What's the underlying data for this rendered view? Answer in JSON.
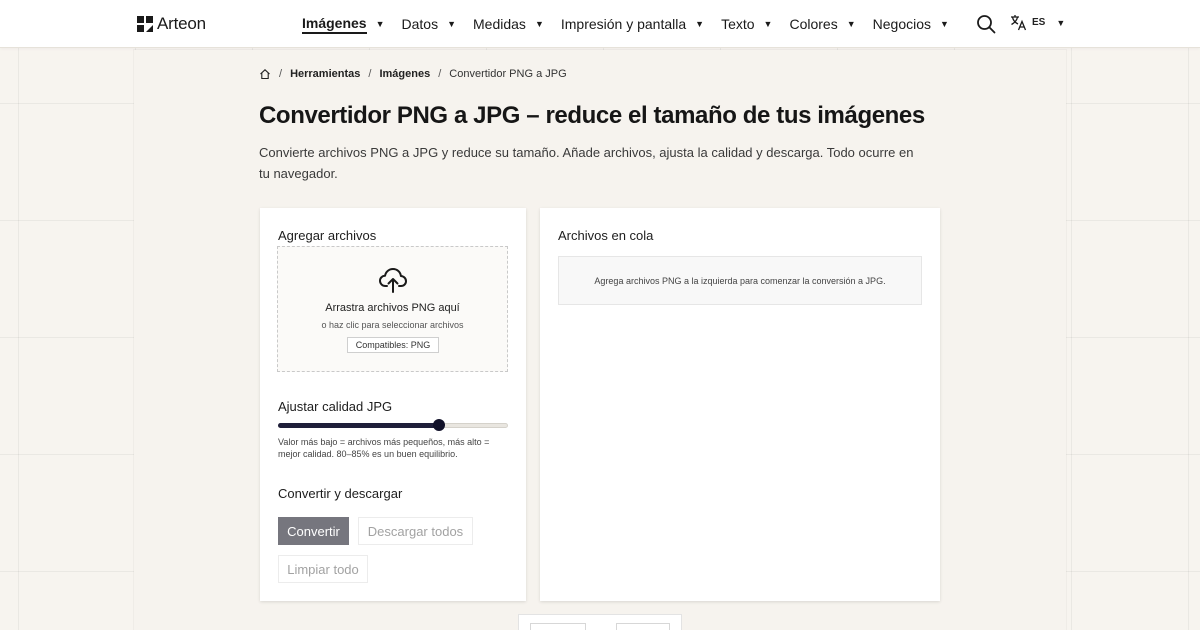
{
  "brand": {
    "name": "Arteon"
  },
  "nav": {
    "items": [
      {
        "label": "Imágenes",
        "active": true
      },
      {
        "label": "Datos",
        "active": false
      },
      {
        "label": "Medidas",
        "active": false
      },
      {
        "label": "Impresión y pantalla",
        "active": false
      },
      {
        "label": "Texto",
        "active": false
      },
      {
        "label": "Colores",
        "active": false
      },
      {
        "label": "Negocios",
        "active": false
      }
    ],
    "caret": "▼"
  },
  "header": {
    "search_icon": "search-icon",
    "language_code": "ES",
    "language_icon": "translate-icon"
  },
  "breadcrumb": {
    "home_icon": "home-icon",
    "separator": "/",
    "items": [
      "Herramientas",
      "Imágenes"
    ],
    "current": "Convertidor PNG a JPG"
  },
  "page": {
    "title": "Convertidor PNG a JPG – reduce el tamaño de tus imágenes",
    "description": "Convierte archivos PNG a JPG y reduce su tamaño. Añade archivos, ajusta la calidad y descarga. Todo ocurre en tu navegador."
  },
  "upload": {
    "title": "Agregar archivos",
    "dropzone_icon": "cloud-upload-icon",
    "dropzone_title": "Arrastra archivos PNG aquí",
    "dropzone_subtitle": "o haz clic para seleccionar archivos",
    "compatible_badge": "Compatibles: PNG"
  },
  "quality": {
    "title": "Ajustar calidad JPG",
    "value_fraction": 0.7,
    "hint": "Valor más bajo = archivos más pequeños, más alto = mejor calidad. 80–85% es un buen equilibrio."
  },
  "actions": {
    "title": "Convertir y descargar",
    "convert_label": "Convertir",
    "download_all_label": "Descargar todos",
    "clear_all_label": "Limpiar todo"
  },
  "queue": {
    "title": "Archivos en cola",
    "empty_message": "Agrega archivos PNG a la izquierda para comenzar la conversión a JPG."
  },
  "colors": {
    "accent": "#1f1f3a",
    "primary_button": "#76767e",
    "background": "#f7f4ef"
  }
}
